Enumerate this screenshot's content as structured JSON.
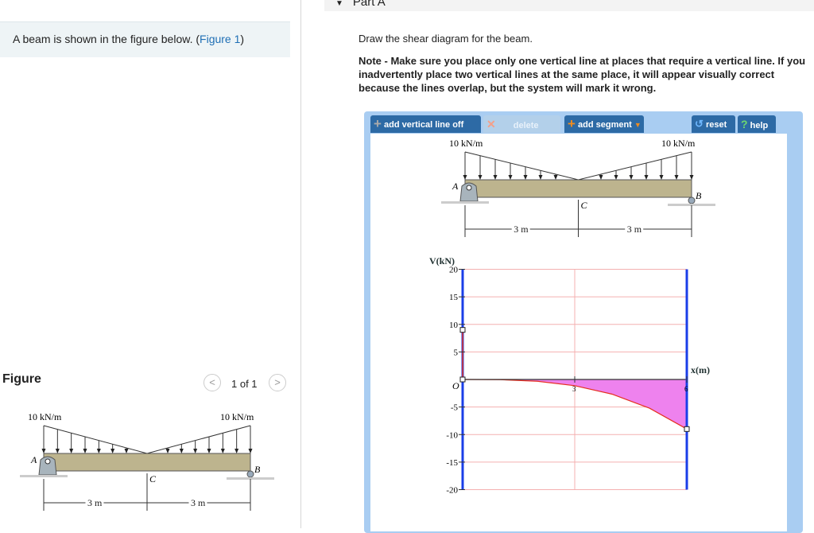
{
  "left": {
    "intro_text": "A beam is shown in the figure below. (",
    "intro_link": "Figure 1",
    "intro_end": ")",
    "figure_title": "Figure",
    "pager": "1 of 1",
    "prev": "<",
    "next": ">"
  },
  "part": {
    "title": "Part A",
    "instruction": "Draw the shear diagram for the beam.",
    "note": "Note - Make sure you place only one vertical line at places that require a vertical line. If you inadvertently place two vertical lines at the same place, it will appear visually correct because the lines overlap, but the system will mark it wrong."
  },
  "toolbar": {
    "add_vertical": "add vertical line off",
    "delete": "delete",
    "add_segment": "add segment",
    "reset": "reset",
    "help": "help"
  },
  "beam": {
    "load_left": "10 kN/m",
    "load_right": "10 kN/m",
    "A": "A",
    "B": "B",
    "C": "C",
    "span1": "3 m",
    "span2": "3 m"
  },
  "chart_data": {
    "type": "line",
    "ylabel": "V(kN)",
    "xlabel": "x(m)",
    "origin": "O",
    "ylim": [
      -20,
      20
    ],
    "xlim": [
      0,
      6
    ],
    "yticks": [
      20,
      15,
      10,
      5,
      -5,
      -10,
      -15,
      -20
    ],
    "xticks": [
      3,
      6
    ],
    "vertical_line": {
      "x": 0,
      "from": 0,
      "to": 9
    },
    "curve": {
      "x": [
        0,
        1,
        2,
        3,
        4,
        5,
        6
      ],
      "y": [
        0,
        -0.04,
        -0.33,
        -1.13,
        -2.67,
        -5.21,
        -9
      ]
    },
    "handles": [
      [
        0,
        9
      ],
      [
        0,
        0
      ],
      [
        6,
        -9
      ]
    ],
    "colors": {
      "fill": "#ee82ee",
      "curve": "#e53020",
      "bounds": "#1a3ee8",
      "grid": "#f4b0b0"
    }
  }
}
